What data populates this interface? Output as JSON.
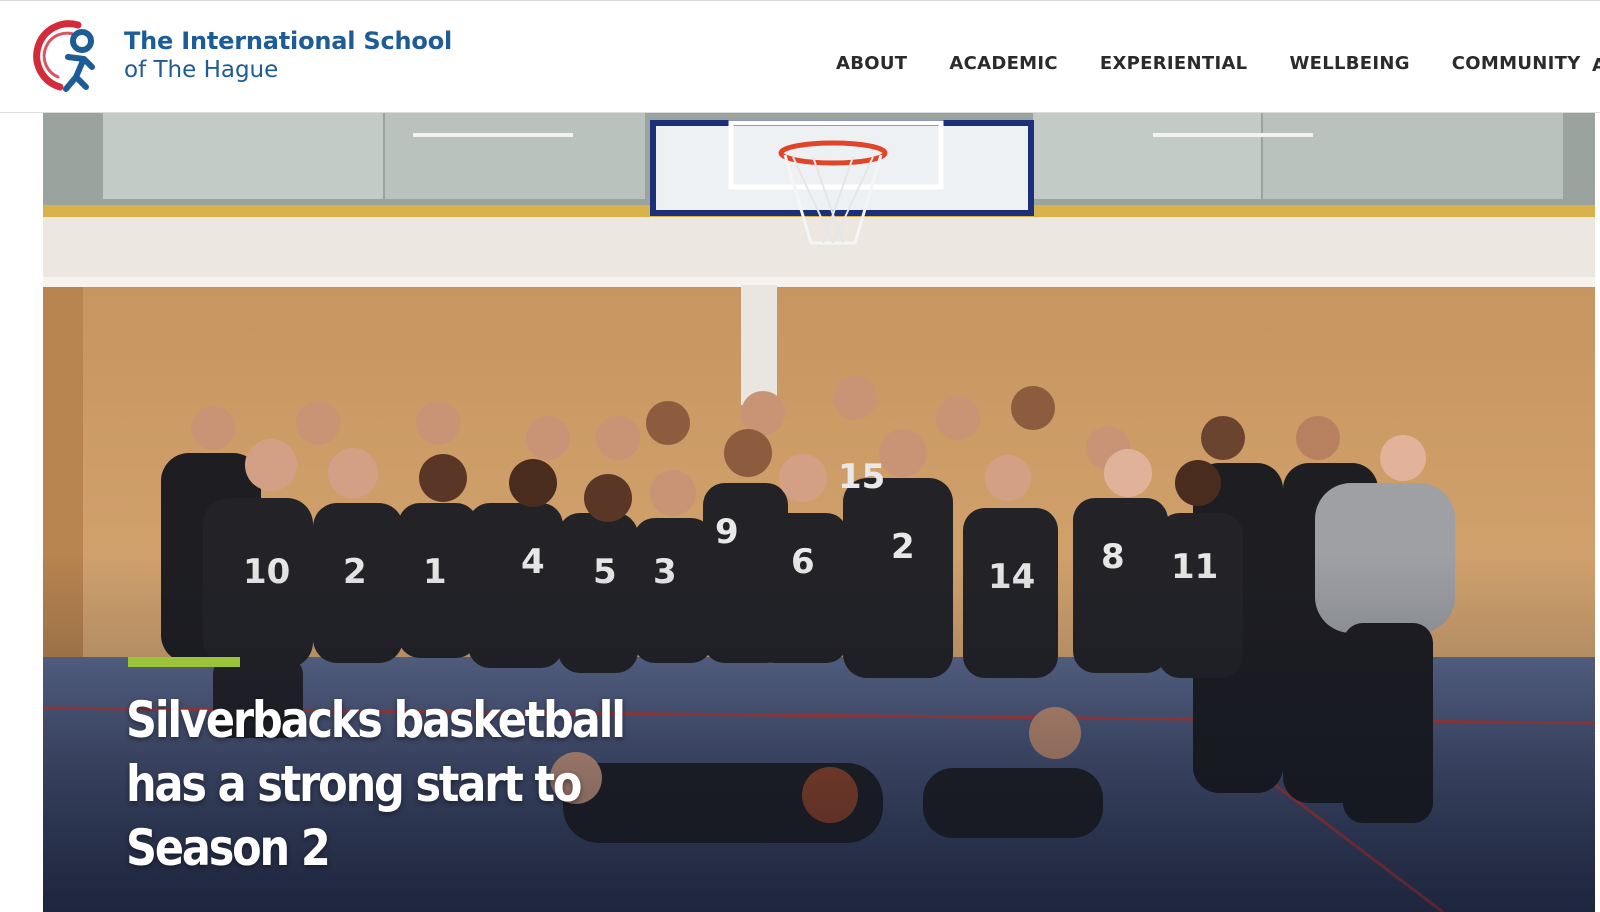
{
  "header": {
    "logo": {
      "line1": "The International School",
      "line2": "of The Hague",
      "icon": "school-emblem-icon",
      "colors": {
        "navy": "#1d5c96",
        "red": "#d22b3a"
      }
    },
    "nav": {
      "items": [
        {
          "label": "ABOUT"
        },
        {
          "label": "ACADEMIC"
        },
        {
          "label": "EXPERIENTIAL"
        },
        {
          "label": "WELLBEING"
        },
        {
          "label": "COMMUNITY"
        }
      ]
    }
  },
  "hero": {
    "title": "Silverbacks basketball has a strong start to Season 2",
    "accent_color": "#9bc43a"
  }
}
